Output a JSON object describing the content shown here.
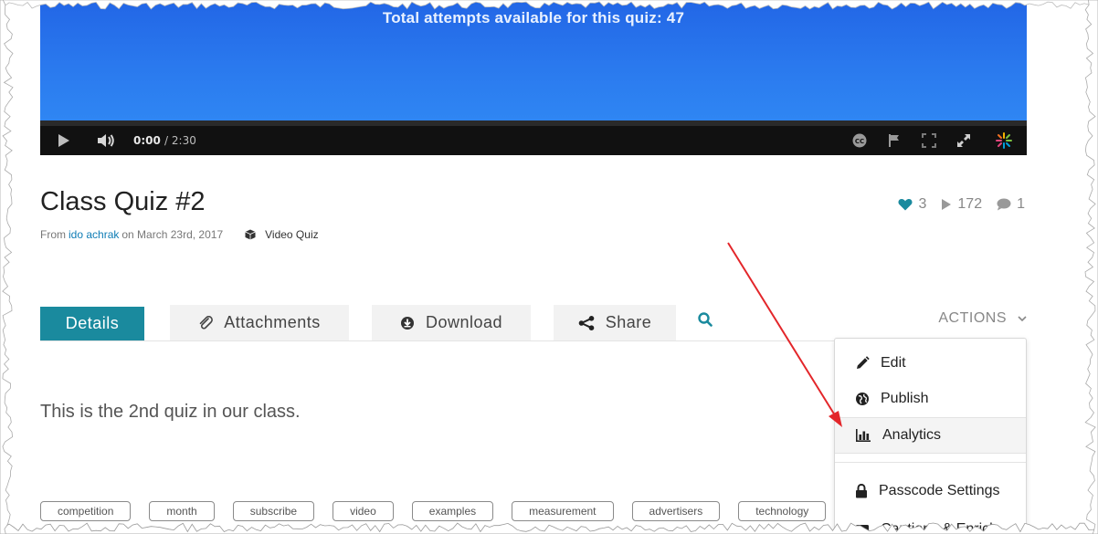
{
  "player": {
    "overlay_text": "Total attempts available for this quiz: 47",
    "current_time": "0:00",
    "duration": "/ 2:30",
    "progress": 0.0
  },
  "entry": {
    "title": "Class Quiz #2",
    "from_prefix": "From",
    "author": "ido achrak",
    "date": "on March 23rd, 2017",
    "type": "Video Quiz",
    "likes": "3",
    "plays": "172",
    "comments": "1",
    "description": "This is the 2nd quiz in our class."
  },
  "tabs": [
    {
      "label": "Details",
      "icon": "none",
      "active": true
    },
    {
      "label": "Attachments",
      "icon": "paperclip-icon",
      "active": false
    },
    {
      "label": "Download",
      "icon": "download-icon",
      "active": false
    },
    {
      "label": "Share",
      "icon": "share-icon",
      "active": false
    }
  ],
  "actions": {
    "label": "ACTIONS",
    "items": [
      {
        "label": "Edit",
        "icon": "pencil-icon"
      },
      {
        "label": "Publish",
        "icon": "globe-icon"
      },
      {
        "label": "Analytics",
        "icon": "bar-chart-icon"
      },
      {
        "label": "Passcode Settings",
        "icon": "lock-icon"
      },
      {
        "label": "Captions & Enrich",
        "icon": "captions-icon"
      }
    ]
  },
  "tags": [
    "competition",
    "month",
    "subscribe",
    "video",
    "examples",
    "measurement",
    "advertisers",
    "technology"
  ],
  "colors": {
    "accent": "#1a8a9e",
    "link": "#0e7cb5",
    "video_blue": "#2a79ee",
    "annotation_arrow": "#e3262a"
  }
}
